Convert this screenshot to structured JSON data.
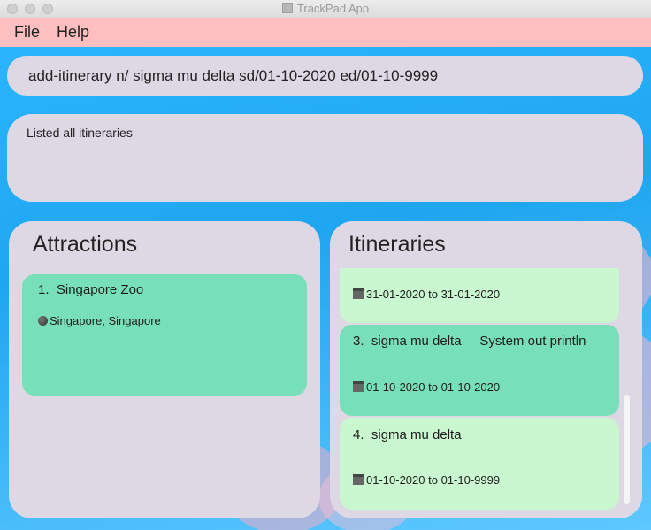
{
  "window": {
    "title": "TrackPad App"
  },
  "menu": {
    "file": "File",
    "help": "Help"
  },
  "command": {
    "value": "add-itinerary n/ sigma mu delta sd/01-10-2020 ed/01-10-9999"
  },
  "result": {
    "text": "Listed all itineraries"
  },
  "attractions": {
    "title": "Attractions",
    "items": [
      {
        "index": "1.",
        "name": "Singapore Zoo",
        "location": "Singapore, Singapore"
      }
    ]
  },
  "itineraries": {
    "title": "Itineraries",
    "items": [
      {
        "dates": "31-01-2020 to 31-01-2020"
      },
      {
        "index": "3.",
        "name": "sigma mu delta",
        "description": "System out println",
        "dates": "01-10-2020 to 01-10-2020"
      },
      {
        "index": "4.",
        "name": "sigma mu delta",
        "dates": "01-10-2020 to 01-10-9999"
      }
    ]
  },
  "colors": {
    "menu_bg": "#ffbfc0",
    "panel_bg": "#ddd8e4",
    "card_selected": "#78e0b8",
    "card_normal": "#c9f7d0",
    "background": "#1ea8f3"
  }
}
